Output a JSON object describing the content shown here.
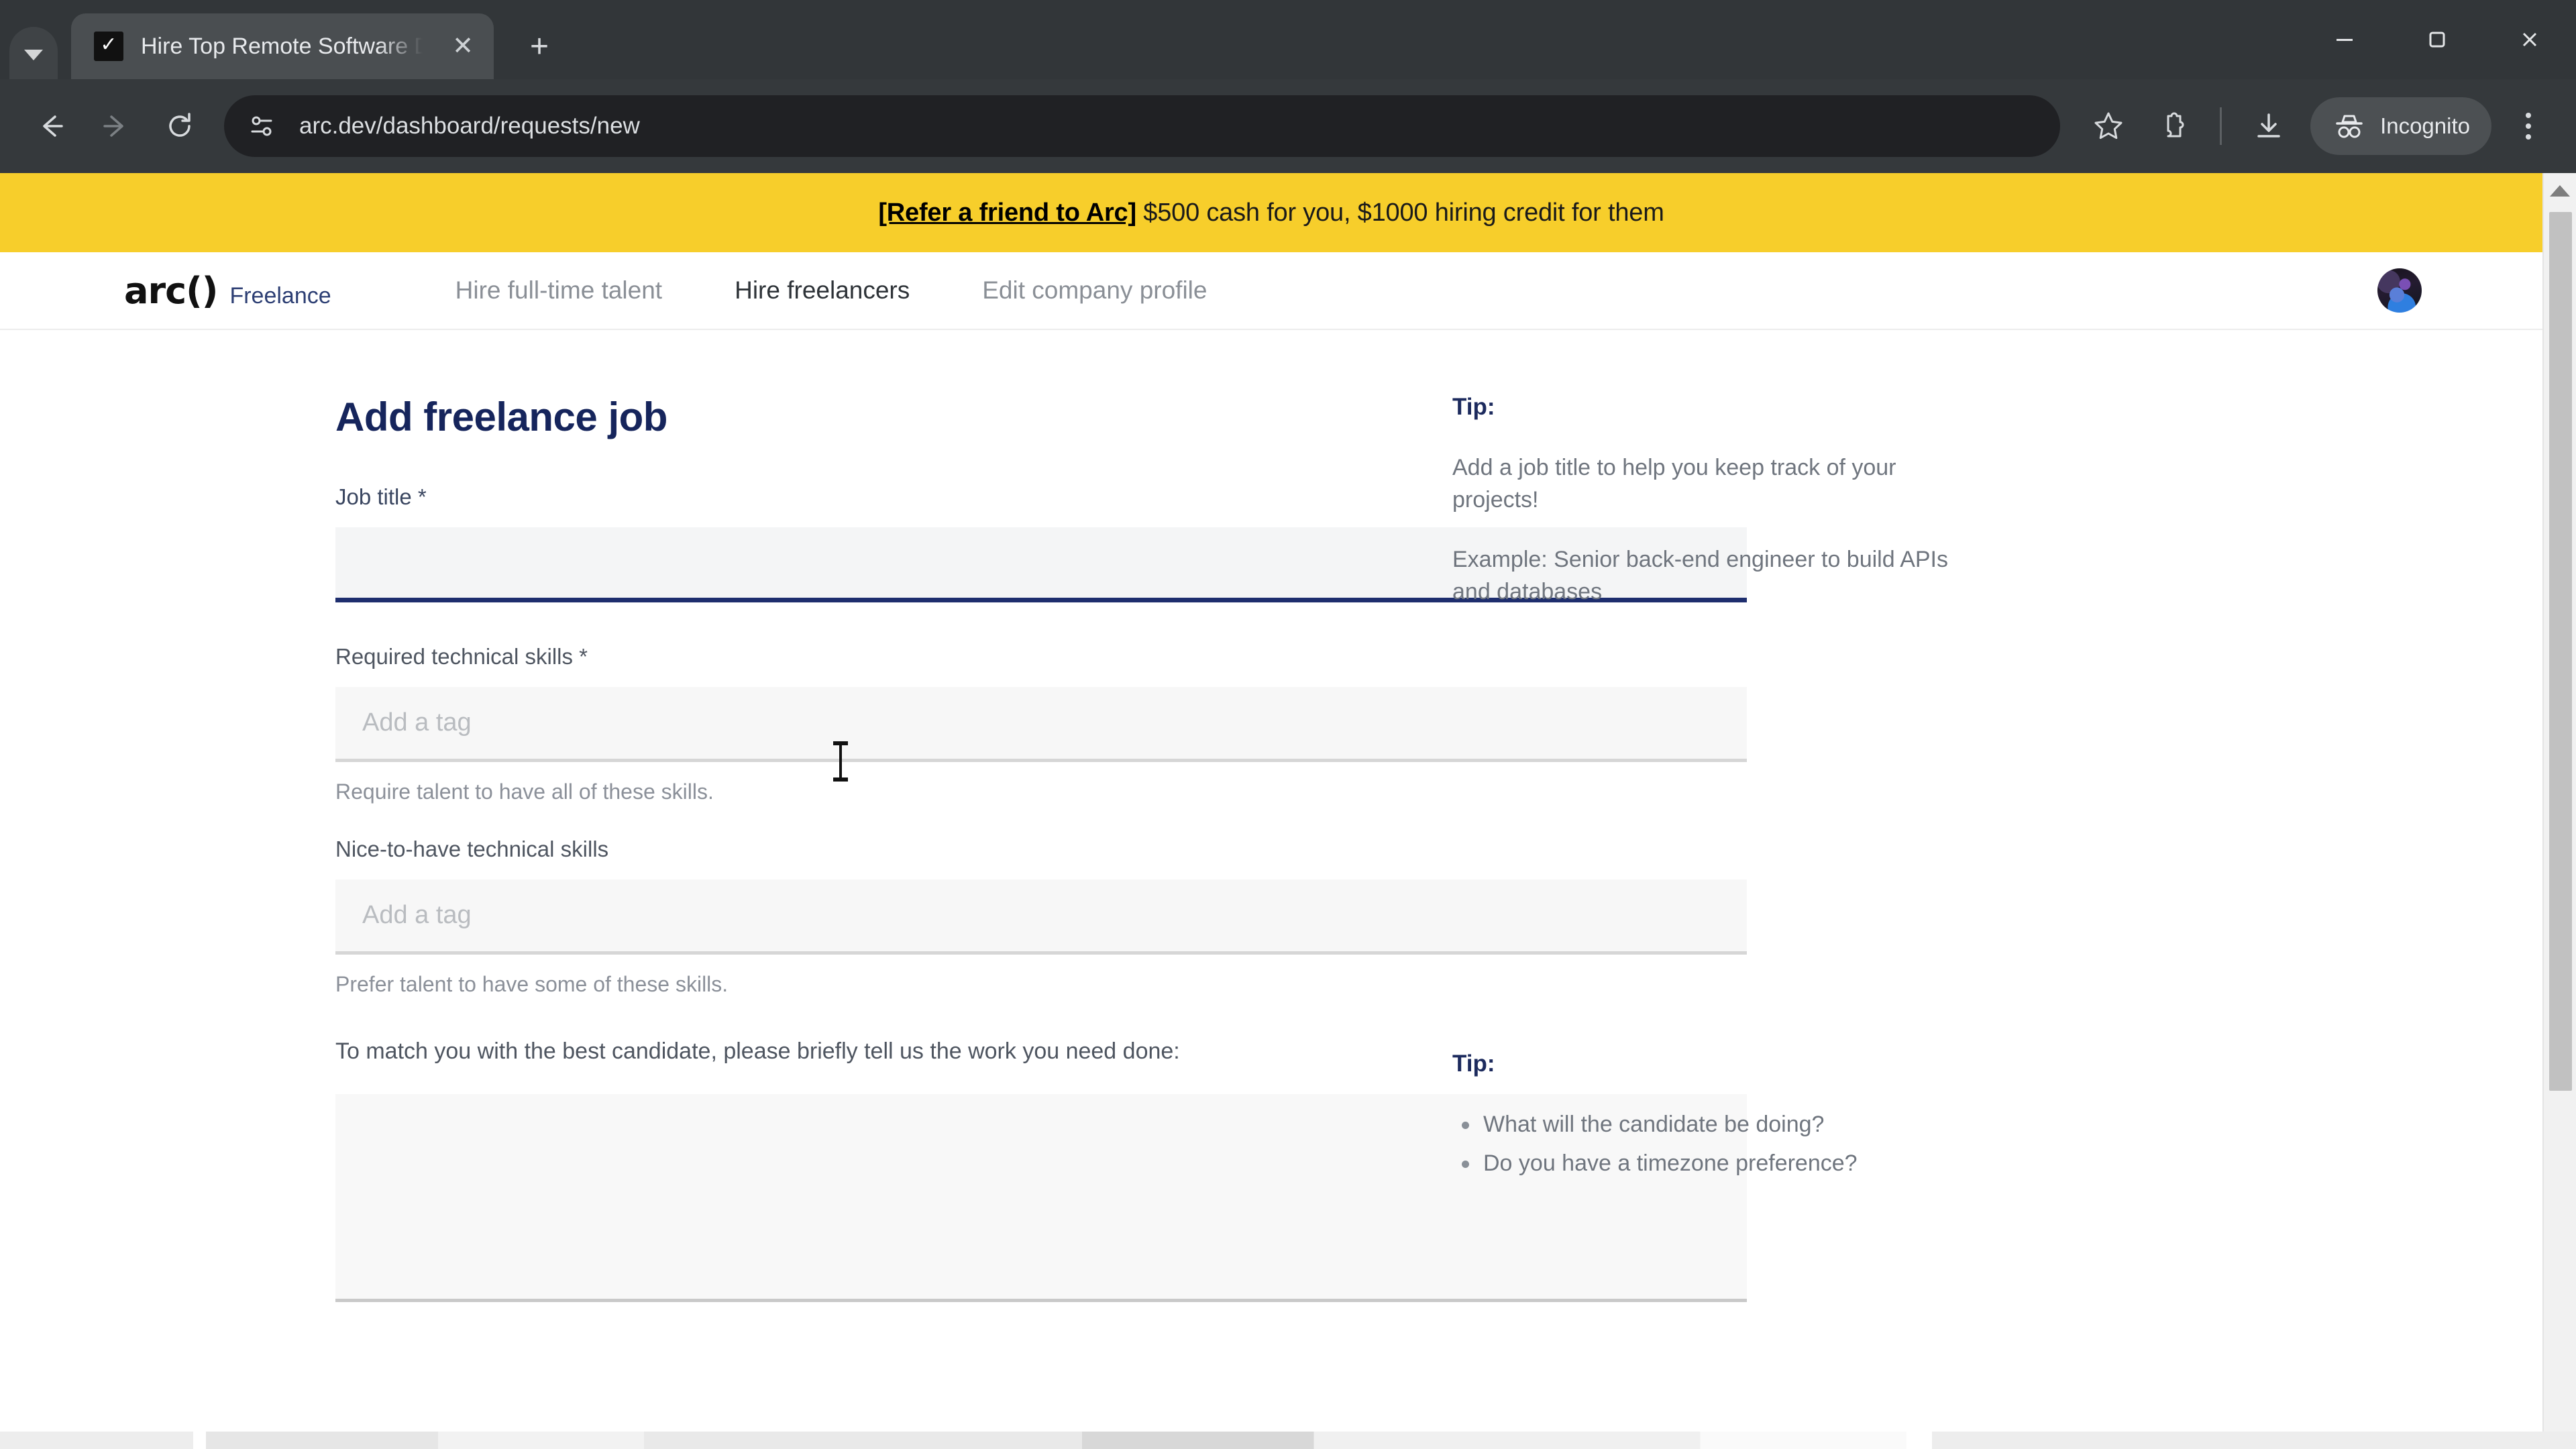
{
  "browser": {
    "tab": {
      "title": "Hire Top Remote Software Deve",
      "favicon_glyph": "✓",
      "close_label": "✕"
    },
    "tab_search_label": "Search tabs",
    "new_tab_label": "+",
    "window_controls": {
      "minimize": "—",
      "maximize": "▢",
      "close": "✕"
    },
    "nav": {
      "back": "←",
      "forward": "→",
      "reload": "⟳"
    },
    "omnibox": {
      "url": "arc.dev/dashboard/requests/new",
      "site_info_icon": "tune-icon"
    },
    "actions": {
      "bookmark": "star-icon",
      "extensions": "puzzle-icon",
      "downloads": "download-icon",
      "incognito_label": "Incognito",
      "menu": "kebab-menu-icon"
    }
  },
  "ribbon": {
    "link_text": "[Refer a friend to Arc]",
    "rest_text": " $500 cash for you, $1000 hiring credit for them",
    "background": "#F7CE2B"
  },
  "sitenav": {
    "brand_mark": "arc()",
    "brand_sub": "Freelance",
    "links": [
      {
        "label": "Hire full-time talent",
        "active": false
      },
      {
        "label": "Hire freelancers",
        "active": true
      },
      {
        "label": "Edit company profile",
        "active": false
      }
    ],
    "avatar_alt": "user-avatar"
  },
  "page": {
    "title": "Add freelance job",
    "fields": {
      "job_title": {
        "label": "Job title *",
        "value": "",
        "placeholder": "",
        "focused": true
      },
      "required_skills": {
        "label": "Required technical skills *",
        "placeholder": "Add a tag",
        "value": "",
        "helper": "Require talent to have all of these skills."
      },
      "nice_to_have_skills": {
        "label": "Nice-to-have technical skills",
        "placeholder": "Add a tag",
        "value": "",
        "helper": "Prefer talent to have some of these skills."
      },
      "description": {
        "prompt": "To match you with the best candidate, please briefly tell us the work you need done:",
        "value": "",
        "placeholder": ""
      }
    },
    "tips": [
      {
        "heading": "Tip:",
        "paragraphs": [
          "Add a job title to help you keep track of your projects!",
          "Example: Senior back-end engineer to build APIs and databases"
        ],
        "bullets": []
      },
      {
        "heading": "Tip:",
        "paragraphs": [],
        "bullets": [
          "What will the candidate be doing?",
          "Do you have a timezone preference?"
        ]
      }
    ]
  },
  "colors": {
    "accent_yellow": "#F7CE2B",
    "navy": "#16255C",
    "focus_underline": "#1E2E6E",
    "muted_text": "#8B9099"
  }
}
